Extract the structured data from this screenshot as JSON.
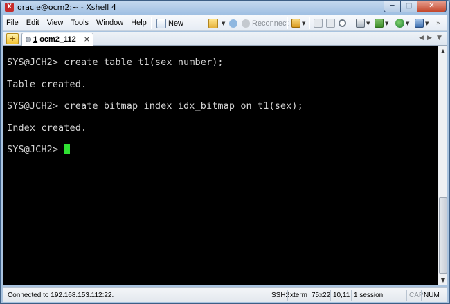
{
  "window": {
    "title": "oracle@ocm2:~ - Xshell 4"
  },
  "menu": [
    "File",
    "Edit",
    "View",
    "Tools",
    "Window",
    "Help"
  ],
  "toolbar": {
    "new_label": "New",
    "reconnect_label": "Reconnect"
  },
  "tab": {
    "number": "1",
    "label": "ocm2_112"
  },
  "terminal": {
    "lines": [
      "SYS@JCH2> create table t1(sex number);",
      "Table created.",
      "SYS@JCH2> create bitmap index idx_bitmap on t1(sex);",
      "Index created.",
      "SYS@JCH2> "
    ],
    "cursor_color": "#2fe032"
  },
  "status": {
    "connection": "Connected to 192.168.153.112:22.",
    "protocol": "SSH2",
    "terminal_type": "xterm",
    "size": "75x22",
    "cursor_pos": "10,11",
    "sessions": "1 session",
    "caps": "CAP",
    "num": "NUM"
  }
}
